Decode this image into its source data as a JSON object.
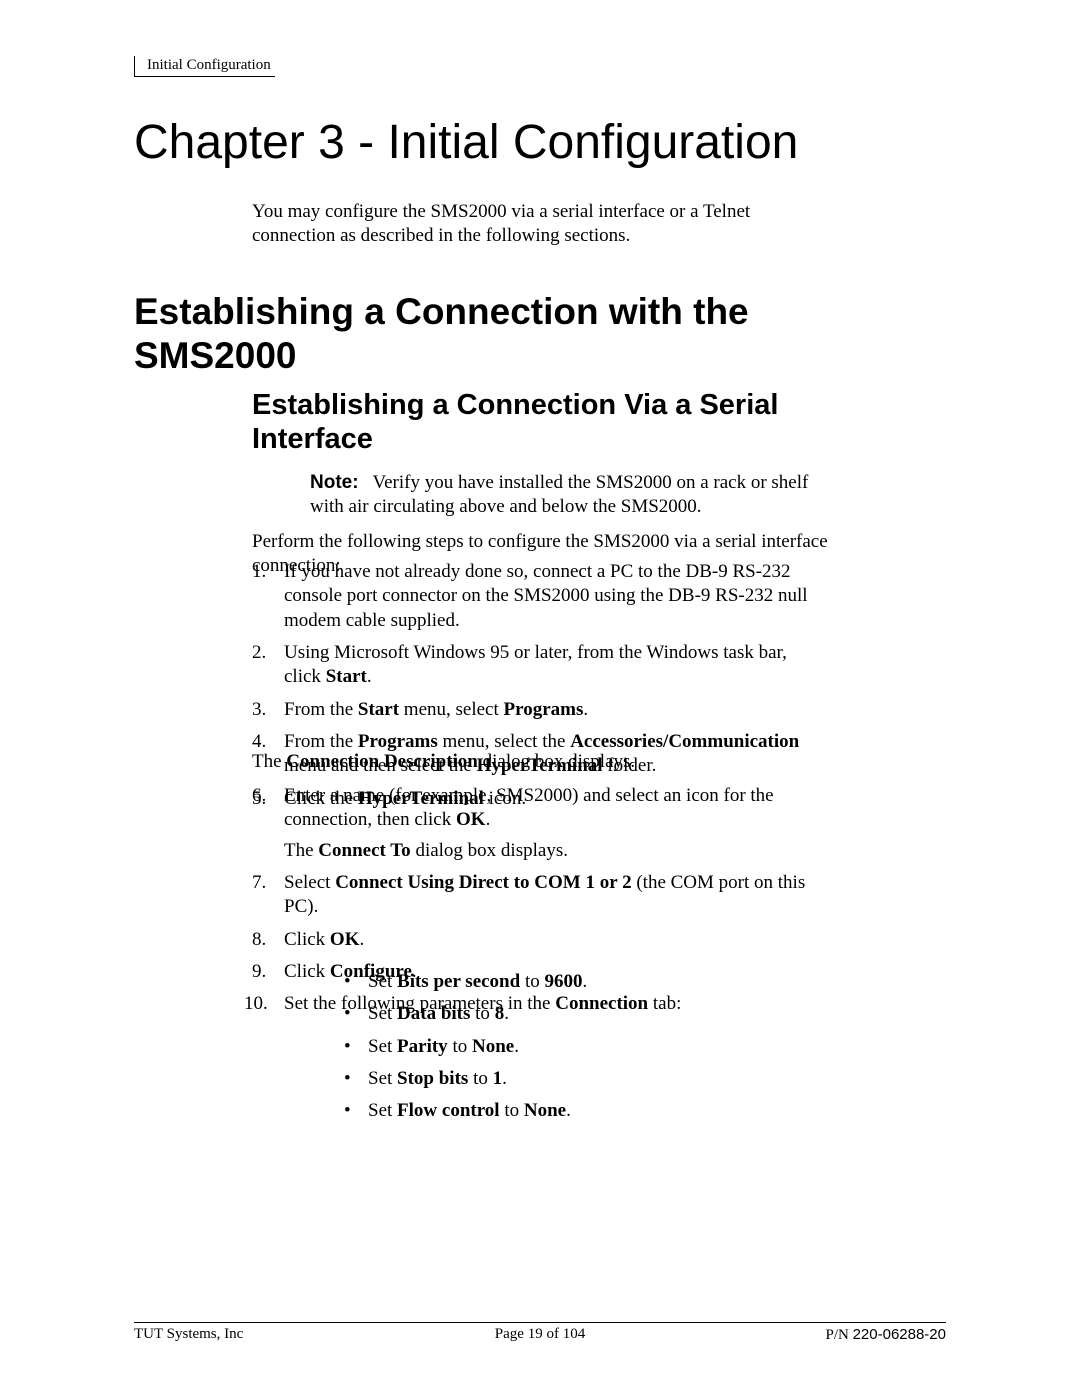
{
  "running_header": "Initial Configuration",
  "h1": "Chapter 3 - Initial Configuration",
  "intro": "You may configure the SMS2000 via a serial interface or a Telnet connection as described in the following sections.",
  "h2": "Establishing a Connection with the SMS2000",
  "h3": "Establishing a Connection Via a Serial Interface",
  "note": {
    "label": "Note:",
    "text": "Verify you have installed the SMS2000 on a rack or shelf with air circulating above and below the SMS2000."
  },
  "perform": "Perform the following steps to configure the SMS2000 via a serial interface connection:",
  "list1": {
    "i1": {
      "n": "1.",
      "t": "If you have not already done so, connect a PC to the DB-9 RS-232 console port connector on the SMS2000 using the DB-9 RS-232 null modem cable supplied."
    },
    "i2": {
      "n": "2.",
      "pre": "Using Microsoft Windows 95 or later, from the Windows task bar, click ",
      "b": "Start",
      "post": "."
    },
    "i3": {
      "n": "3.",
      "pre": "From the ",
      "b1": "Start",
      "mid": " menu, select ",
      "b2": "Programs",
      "post": "."
    },
    "i4": {
      "n": "4.",
      "pre": "From the ",
      "b1": "Programs",
      "mid1": " menu, select the ",
      "b2": "Accessories/Communication",
      "mid2": " menu and then select the ",
      "b3": "HyperTerminal",
      "post": " folder."
    },
    "i5": {
      "n": "5.",
      "pre": "Click the ",
      "b": "HyperTerminal",
      "post": " icon."
    }
  },
  "dialog1": {
    "pre": "The ",
    "b": "Connection Description",
    "post": " dialog box displays."
  },
  "list2": {
    "i6": {
      "n": "6.",
      "line1_pre": "Enter a name (for example, SMS2000) and select an icon for the connection, then click ",
      "line1_b": "OK",
      "line1_post": ".",
      "line2_pre": "The ",
      "line2_b": "Connect To",
      "line2_post": " dialog box displays."
    },
    "i7": {
      "n": "7.",
      "pre": "Select ",
      "b": "Connect Using Direct to COM 1 or 2",
      "post": " (the COM port on this PC)."
    },
    "i8": {
      "n": "8.",
      "pre": "Click ",
      "b": "OK",
      "post": "."
    },
    "i9": {
      "n": "9.",
      "pre": "Click ",
      "b": "Configure",
      "post": "."
    },
    "i10": {
      "n": "10.",
      "pre": "Set the following parameters in the ",
      "b": "Connection",
      "post": " tab:"
    }
  },
  "bullets": {
    "b1": {
      "pre": "Set ",
      "b1": "Bits per second",
      "mid": " to ",
      "b2": "9600",
      "post": "."
    },
    "b2": {
      "pre": "Set ",
      "b1": "Data bits",
      "mid": " to ",
      "b2": "8",
      "post": "."
    },
    "b3": {
      "pre": "Set ",
      "b1": "Parity",
      "mid": " to ",
      "b2": "None",
      "post": "."
    },
    "b4": {
      "pre": "Set ",
      "b1": "Stop bits",
      "mid": " to ",
      "b2": "1",
      "post": "."
    },
    "b5": {
      "pre": "Set ",
      "b1": "Flow control",
      "mid": " to ",
      "b2": "None",
      "post": "."
    }
  },
  "footer": {
    "left": "TUT Systems, Inc",
    "center": "Page 19 of 104",
    "right_label": "P/N ",
    "right_value": "220-06288-20"
  }
}
